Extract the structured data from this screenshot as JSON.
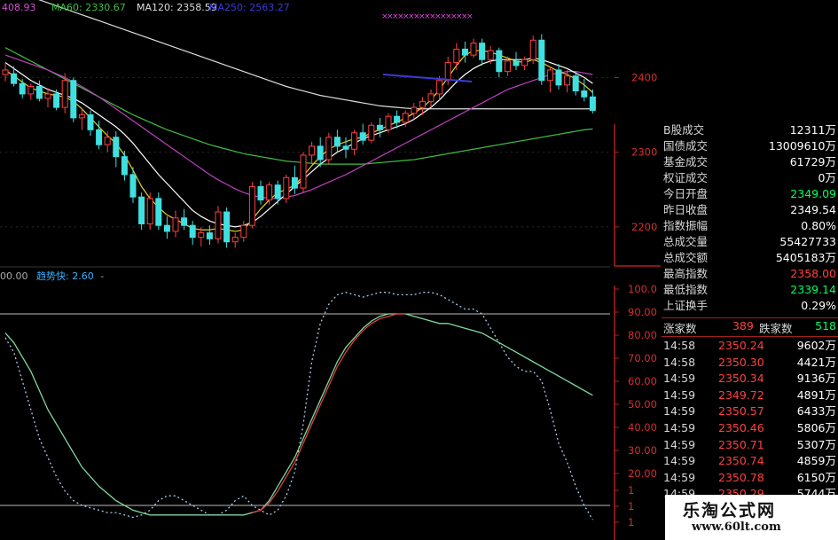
{
  "header": {
    "ma_values": [
      {
        "text": "408.93",
        "color": "#d050d0"
      },
      {
        "text": "MA60: 2330.67",
        "color": "#40c040"
      },
      {
        "text": "MA120: 2358.59",
        "color": "#dddddd"
      },
      {
        "text": "MA250: 2563.27",
        "color": "#3b3bd8"
      }
    ]
  },
  "indicator": {
    "left_value": "00.00",
    "name": "趋势快: 2.60",
    "sep": "-"
  },
  "price_axis": {
    "labels": [
      "2400",
      "2300",
      "2200"
    ]
  },
  "osc_axis": {
    "labels": [
      "100.0",
      "90.00",
      "80.00",
      "70.00",
      "60.00",
      "50.00",
      "40.00",
      "30.00",
      "20.00",
      "1",
      "1",
      "1"
    ]
  },
  "stats": [
    {
      "label": "B股成交",
      "value": "12311万",
      "color": "#ffffff"
    },
    {
      "label": "国债成交",
      "value": "13009610万",
      "color": "#ffffff"
    },
    {
      "label": "基金成交",
      "value": "61729万",
      "color": "#ffffff"
    },
    {
      "label": "权证成交",
      "value": "0万",
      "color": "#ffffff"
    },
    {
      "label": "今日开盘",
      "value": "2349.09",
      "color": "#00ff60"
    },
    {
      "label": "昨日收盘",
      "value": "2349.54",
      "color": "#ffffff"
    },
    {
      "label": "指数振幅",
      "value": "0.80%",
      "color": "#ffffff"
    },
    {
      "label": "总成交量",
      "value": "55427733",
      "color": "#ffffff"
    },
    {
      "label": "总成交额",
      "value": "5405183万",
      "color": "#ffffff"
    },
    {
      "label": "最高指数",
      "value": "2358.00",
      "color": "#ff4040"
    },
    {
      "label": "最低指数",
      "value": "2339.14",
      "color": "#00ff60"
    },
    {
      "label": "上证换手",
      "value": "0.29%",
      "color": "#ffffff"
    }
  ],
  "breadth": {
    "up_label": "涨家数",
    "up_value": "389",
    "down_label": "跌家数",
    "down_value": "518"
  },
  "ticks": [
    {
      "time": "14:58",
      "price": "2350.24",
      "volume": "9602万"
    },
    {
      "time": "14:58",
      "price": "2350.30",
      "volume": "4421万"
    },
    {
      "time": "14:59",
      "price": "2350.34",
      "volume": "9136万"
    },
    {
      "time": "14:59",
      "price": "2349.72",
      "volume": "4891万"
    },
    {
      "time": "14:59",
      "price": "2350.57",
      "volume": "6433万"
    },
    {
      "time": "14:59",
      "price": "2350.46",
      "volume": "5806万"
    },
    {
      "time": "14:59",
      "price": "2350.71",
      "volume": "5307万"
    },
    {
      "time": "14:59",
      "price": "2350.74",
      "volume": "4859万"
    },
    {
      "time": "14:59",
      "price": "2350.78",
      "volume": "6150万"
    },
    {
      "time": "14:59",
      "price": "2350.29",
      "volume": "5744万"
    }
  ],
  "watermark": {
    "title": "乐淘公式网",
    "url": "www.60lt.com"
  },
  "chart_data": {
    "type": "candlestick",
    "price_ylim": [
      2150,
      2480
    ],
    "osc_ylim": [
      0,
      100
    ],
    "candles": [
      [
        2404,
        2420,
        2395,
        2410
      ],
      [
        2405,
        2415,
        2388,
        2392
      ],
      [
        2392,
        2398,
        2372,
        2378
      ],
      [
        2378,
        2392,
        2370,
        2388
      ],
      [
        2388,
        2396,
        2368,
        2372
      ],
      [
        2372,
        2386,
        2360,
        2378
      ],
      [
        2378,
        2384,
        2356,
        2360
      ],
      [
        2360,
        2406,
        2352,
        2396
      ],
      [
        2396,
        2400,
        2340,
        2346
      ],
      [
        2346,
        2358,
        2330,
        2350
      ],
      [
        2350,
        2356,
        2322,
        2330
      ],
      [
        2330,
        2342,
        2304,
        2310
      ],
      [
        2310,
        2328,
        2300,
        2320
      ],
      [
        2320,
        2328,
        2280,
        2294
      ],
      [
        2294,
        2302,
        2262,
        2270
      ],
      [
        2270,
        2280,
        2232,
        2240
      ],
      [
        2240,
        2246,
        2196,
        2204
      ],
      [
        2204,
        2246,
        2196,
        2238
      ],
      [
        2238,
        2246,
        2196,
        2202
      ],
      [
        2202,
        2214,
        2184,
        2194
      ],
      [
        2194,
        2222,
        2186,
        2212
      ],
      [
        2212,
        2224,
        2196,
        2202
      ],
      [
        2202,
        2208,
        2176,
        2186
      ],
      [
        2186,
        2200,
        2174,
        2192
      ],
      [
        2192,
        2202,
        2176,
        2184
      ],
      [
        2184,
        2228,
        2178,
        2220
      ],
      [
        2220,
        2226,
        2172,
        2180
      ],
      [
        2180,
        2192,
        2172,
        2186
      ],
      [
        2186,
        2208,
        2180,
        2202
      ],
      [
        2202,
        2260,
        2198,
        2254
      ],
      [
        2254,
        2262,
        2230,
        2236
      ],
      [
        2236,
        2260,
        2230,
        2256
      ],
      [
        2256,
        2262,
        2230,
        2238
      ],
      [
        2238,
        2270,
        2232,
        2266
      ],
      [
        2266,
        2282,
        2244,
        2252
      ],
      [
        2252,
        2300,
        2246,
        2296
      ],
      [
        2296,
        2314,
        2286,
        2308
      ],
      [
        2308,
        2320,
        2280,
        2290
      ],
      [
        2290,
        2326,
        2284,
        2320
      ],
      [
        2320,
        2330,
        2300,
        2308
      ],
      [
        2308,
        2320,
        2292,
        2304
      ],
      [
        2304,
        2330,
        2296,
        2326
      ],
      [
        2326,
        2338,
        2310,
        2316
      ],
      [
        2316,
        2340,
        2312,
        2336
      ],
      [
        2336,
        2346,
        2320,
        2330
      ],
      [
        2330,
        2352,
        2326,
        2348
      ],
      [
        2348,
        2356,
        2332,
        2340
      ],
      [
        2340,
        2356,
        2334,
        2352
      ],
      [
        2352,
        2366,
        2344,
        2360
      ],
      [
        2360,
        2374,
        2350,
        2368
      ],
      [
        2368,
        2384,
        2360,
        2378
      ],
      [
        2378,
        2402,
        2370,
        2396
      ],
      [
        2396,
        2428,
        2390,
        2420
      ],
      [
        2420,
        2446,
        2410,
        2438
      ],
      [
        2438,
        2448,
        2420,
        2430
      ],
      [
        2430,
        2452,
        2426,
        2446
      ],
      [
        2446,
        2452,
        2416,
        2424
      ],
      [
        2424,
        2442,
        2418,
        2436
      ],
      [
        2436,
        2440,
        2400,
        2408
      ],
      [
        2408,
        2428,
        2402,
        2422
      ],
      [
        2422,
        2434,
        2410,
        2416
      ],
      [
        2416,
        2428,
        2410,
        2424
      ],
      [
        2424,
        2456,
        2418,
        2450
      ],
      [
        2450,
        2458,
        2390,
        2396
      ],
      [
        2396,
        2414,
        2380,
        2410
      ],
      [
        2410,
        2418,
        2384,
        2390
      ],
      [
        2390,
        2410,
        2380,
        2402
      ],
      [
        2402,
        2408,
        2376,
        2382
      ],
      [
        2382,
        2398,
        2368,
        2374
      ],
      [
        2374,
        2384,
        2352,
        2356
      ]
    ],
    "ma_series": [
      {
        "name": "MA60",
        "color": "#40c040",
        "values": [
          2440,
          2434,
          2428,
          2422,
          2416,
          2410,
          2404,
          2398,
          2392,
          2386,
          2380,
          2374,
          2368,
          2362,
          2356,
          2350,
          2345,
          2340,
          2335,
          2330,
          2326,
          2322,
          2318,
          2314,
          2310,
          2307,
          2304,
          2301,
          2298,
          2296,
          2294,
          2292,
          2290,
          2288,
          2287,
          2286,
          2285,
          2284,
          2284,
          2284,
          2284,
          2284,
          2284,
          2285,
          2286,
          2287,
          2288,
          2289,
          2290,
          2292,
          2294,
          2296,
          2298,
          2300,
          2302,
          2304,
          2306,
          2308,
          2310,
          2312,
          2314,
          2316,
          2318,
          2320,
          2322,
          2324,
          2326,
          2328,
          2330,
          2331
        ]
      },
      {
        "name": "MA120",
        "color": "#dddddd",
        "values": [
          2520,
          2516,
          2512,
          2508,
          2504,
          2500,
          2496,
          2492,
          2488,
          2484,
          2480,
          2476,
          2472,
          2468,
          2464,
          2460,
          2456,
          2452,
          2448,
          2444,
          2440,
          2436,
          2432,
          2428,
          2424,
          2420,
          2416,
          2412,
          2408,
          2404,
          2400,
          2396,
          2392,
          2388,
          2385,
          2382,
          2379,
          2376,
          2374,
          2372,
          2370,
          2368,
          2366,
          2364,
          2362,
          2361,
          2360,
          2359,
          2358,
          2358,
          2358,
          2358,
          2358,
          2358,
          2358,
          2358,
          2358,
          2358,
          2358,
          2358,
          2358,
          2358,
          2358,
          2358,
          2358,
          2358,
          2358,
          2358,
          2358,
          2358
        ]
      },
      {
        "name": "MA30",
        "color": "#c040c0",
        "values": [
          2430,
          2426,
          2422,
          2418,
          2414,
          2410,
          2405,
          2400,
          2394,
          2388,
          2381,
          2374,
          2366,
          2358,
          2350,
          2342,
          2334,
          2326,
          2318,
          2310,
          2302,
          2294,
          2286,
          2278,
          2270,
          2263,
          2257,
          2251,
          2246,
          2242,
          2240,
          2238,
          2238,
          2240,
          2242,
          2246,
          2250,
          2255,
          2260,
          2265,
          2270,
          2276,
          2282,
          2288,
          2294,
          2300,
          2306,
          2312,
          2318,
          2324,
          2330,
          2336,
          2342,
          2348,
          2354,
          2360,
          2366,
          2372,
          2378,
          2384,
          2388,
          2392,
          2396,
          2400,
          2404,
          2406,
          2408,
          2408,
          2406,
          2404
        ]
      },
      {
        "name": "MA10",
        "color": "#ffffff",
        "values": [
          2420,
          2412,
          2404,
          2396,
          2390,
          2384,
          2380,
          2376,
          2372,
          2366,
          2358,
          2350,
          2342,
          2334,
          2324,
          2312,
          2298,
          2284,
          2270,
          2258,
          2246,
          2234,
          2222,
          2214,
          2208,
          2204,
          2202,
          2200,
          2202,
          2206,
          2214,
          2224,
          2234,
          2244,
          2254,
          2264,
          2274,
          2284,
          2292,
          2300,
          2306,
          2312,
          2318,
          2322,
          2326,
          2330,
          2334,
          2338,
          2344,
          2352,
          2360,
          2370,
          2382,
          2394,
          2404,
          2412,
          2418,
          2422,
          2424,
          2424,
          2424,
          2424,
          2426,
          2424,
          2420,
          2416,
          2412,
          2406,
          2400,
          2392
        ]
      },
      {
        "name": "MA5",
        "color": "#e8d020",
        "values": [
          2410,
          2402,
          2394,
          2386,
          2382,
          2378,
          2376,
          2374,
          2368,
          2358,
          2346,
          2334,
          2322,
          2312,
          2296,
          2276,
          2254,
          2238,
          2226,
          2216,
          2210,
          2204,
          2198,
          2196,
          2196,
          2198,
          2196,
          2194,
          2196,
          2210,
          2224,
          2236,
          2246,
          2250,
          2256,
          2268,
          2282,
          2294,
          2304,
          2310,
          2314,
          2318,
          2320,
          2326,
          2330,
          2336,
          2340,
          2346,
          2352,
          2360,
          2370,
          2384,
          2400,
          2416,
          2430,
          2436,
          2436,
          2434,
          2430,
          2426,
          2422,
          2420,
          2424,
          2420,
          2414,
          2408,
          2404,
          2398,
          2390,
          2380
        ]
      }
    ],
    "osc_series": [
      {
        "name": "fast-dotted",
        "color": "#a8c8e8",
        "values": [
          80,
          74,
          62,
          50,
          38,
          30,
          22,
          16,
          12,
          10,
          9,
          8,
          7,
          7,
          6,
          5,
          6,
          8,
          12,
          14,
          14,
          12,
          10,
          8,
          6,
          6,
          8,
          12,
          14,
          10,
          8,
          6,
          8,
          14,
          24,
          44,
          70,
          86,
          94,
          98,
          99,
          98,
          97,
          98,
          99,
          99,
          98,
          98,
          98,
          99,
          99,
          98,
          96,
          94,
          92,
          92,
          90,
          84,
          78,
          72,
          68,
          66,
          66,
          62,
          50,
          36,
          28,
          18,
          10,
          4
        ]
      },
      {
        "name": "slow-green",
        "color": "#80d8a0",
        "values": [
          82,
          78,
          72,
          66,
          58,
          50,
          44,
          38,
          32,
          26,
          22,
          18,
          15,
          12,
          10,
          8,
          7,
          6,
          6,
          6,
          6,
          6,
          6,
          6,
          6,
          6,
          6,
          6,
          6,
          7,
          8,
          12,
          18,
          24,
          30,
          38,
          46,
          54,
          62,
          70,
          76,
          80,
          84,
          87,
          89,
          90,
          90,
          90,
          89,
          88,
          87,
          86,
          86,
          85,
          84,
          83,
          82,
          80,
          78,
          76,
          74,
          72,
          70,
          68,
          66,
          64,
          62,
          60,
          58,
          56
        ]
      },
      {
        "name": "signal-red",
        "color": "#e04040",
        "values": [
          null,
          null,
          null,
          null,
          null,
          null,
          null,
          null,
          null,
          null,
          null,
          null,
          null,
          null,
          null,
          null,
          null,
          null,
          null,
          null,
          null,
          null,
          null,
          null,
          null,
          null,
          null,
          null,
          null,
          7,
          8,
          11,
          16,
          22,
          28,
          36,
          44,
          52,
          60,
          68,
          74,
          79,
          83,
          86,
          88,
          89,
          90,
          90,
          null,
          null,
          null,
          null,
          null,
          null,
          null,
          null,
          null,
          null,
          null,
          null,
          null,
          null,
          null,
          null,
          null,
          null,
          null,
          null,
          null,
          null
        ]
      }
    ],
    "osc_levels": [
      90,
      10
    ]
  }
}
